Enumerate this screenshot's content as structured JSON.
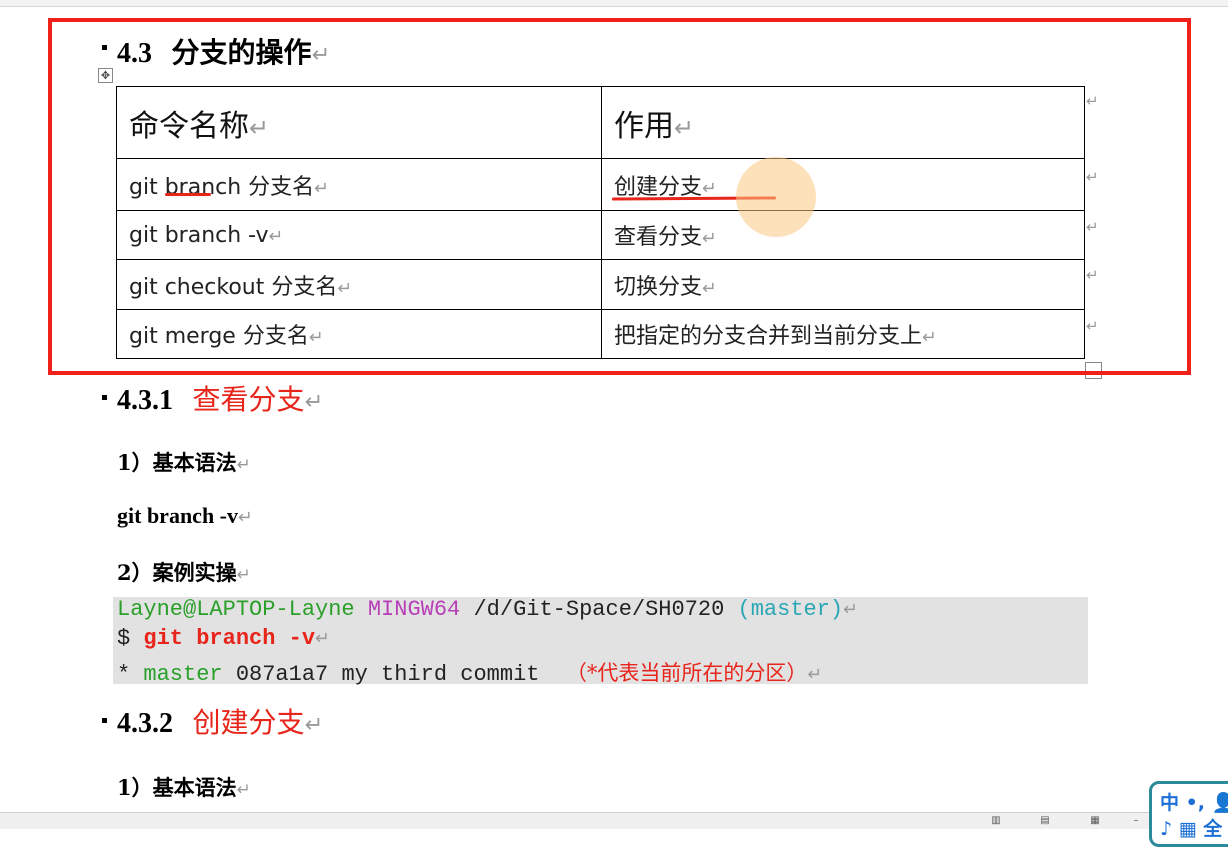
{
  "section": {
    "number": "4.3",
    "title": "分支的操作"
  },
  "table": {
    "headers": [
      "命令名称",
      "作用"
    ],
    "rows": [
      {
        "cmd": "git branch  分支名",
        "desc": "创建分支"
      },
      {
        "cmd": "git branch -v",
        "desc": "查看分支"
      },
      {
        "cmd": "git checkout  分支名",
        "desc": "切换分支"
      },
      {
        "cmd": "git merge  分支名",
        "desc": "把指定的分支合并到当前分支上"
      }
    ]
  },
  "sub1": {
    "number": "4.3.1",
    "title": "查看分支",
    "step1": "1）基本语法",
    "syntax": "git branch -v",
    "step2": "2）案例实操"
  },
  "code": {
    "prompt_user": "Layne@LAPTOP-Layne",
    "prompt_env": "MINGW64",
    "prompt_path": "/d/Git-Space/SH0720",
    "prompt_branch": "(master)",
    "cmd_prefix": "$ ",
    "cmd": "git branch -v",
    "out_star": "* ",
    "out_branch": "master",
    "out_rest": " 087a1a7 my third commit  ",
    "out_note": "（*代表当前所在的分区）"
  },
  "sub2": {
    "number": "4.3.2",
    "title": "创建分支",
    "step1": "1）基本语法"
  },
  "ime": {
    "row1": "中 •, 👤",
    "row2": "♪ ▦ 全"
  },
  "paragraph_mark": "↵",
  "colors": {
    "frame_red": "#f0211b",
    "heading_red": "#e8251b",
    "code_bg": "#e2e2e2"
  }
}
